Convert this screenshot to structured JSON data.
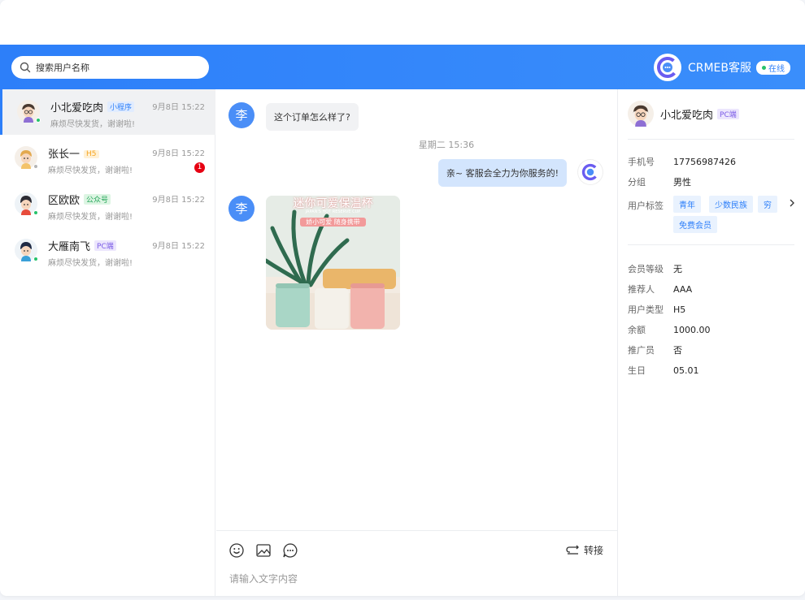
{
  "search": {
    "placeholder": "搜索用户名称"
  },
  "agent": {
    "name": "CRMEB客服",
    "status": "在线"
  },
  "conversations": [
    {
      "name": "小北爱吃肉",
      "tag": "小程序",
      "tag_bg": "#e1ecfe",
      "tag_color": "#2d7ff9",
      "message": "麻烦尽快发货，谢谢啦!",
      "time": "9月8日 15:22",
      "online": true
    },
    {
      "name": "张长一",
      "tag": "H5",
      "tag_bg": "#fff1d6",
      "tag_color": "#f6a623",
      "message": "麻烦尽快发货，谢谢啦!",
      "time": "9月8日 15:22",
      "unread": "1",
      "online": false
    },
    {
      "name": "区欧欧",
      "tag": "公众号",
      "tag_bg": "#ddf5e3",
      "tag_color": "#26a65b",
      "message": "麻烦尽快发货，谢谢啦!",
      "time": "9月8日 15:22",
      "online": true
    },
    {
      "name": "大雁南飞",
      "tag": "PC端",
      "tag_bg": "#ece6fd",
      "tag_color": "#7b5ce6",
      "message": "麻烦尽快发货，谢谢啦!",
      "time": "9月8日 15:22",
      "online": true
    }
  ],
  "chat": {
    "user_avatar_char": "李",
    "msg1": "这个订单怎么样了?",
    "timestamp": "星期二 15:36",
    "msg2": "亲~ 客服会全力为你服务的!",
    "image_title": "迷你可爱保温杯",
    "image_subtitle": "JAPAN'S HOT RESERVE CUP",
    "image_tag": "娇小可爱 随身携带"
  },
  "toolbar": {
    "transfer_label": "转接",
    "input_placeholder": "请输入文字内容"
  },
  "profile": {
    "name": "小北爱吃肉",
    "tag": "PC端",
    "phone_label": "手机号",
    "phone": "17756987426",
    "group_label": "分组",
    "group": "男性",
    "tags_label": "用户标签",
    "tags": [
      "青年",
      "少数民族",
      "穷",
      "免费会员"
    ],
    "level_label": "会员等级",
    "level": "无",
    "referrer_label": "推荐人",
    "referrer": "AAA",
    "type_label": "用户类型",
    "type": "H5",
    "balance_label": "余额",
    "balance": "1000.00",
    "promoter_label": "推广员",
    "promoter": "否",
    "birthday_label": "生日",
    "birthday": "05.01"
  },
  "colors": {
    "primary": "#2d7ff9",
    "online": "#26c26b",
    "offline": "#b5b5b5",
    "unread": "#e60012"
  }
}
